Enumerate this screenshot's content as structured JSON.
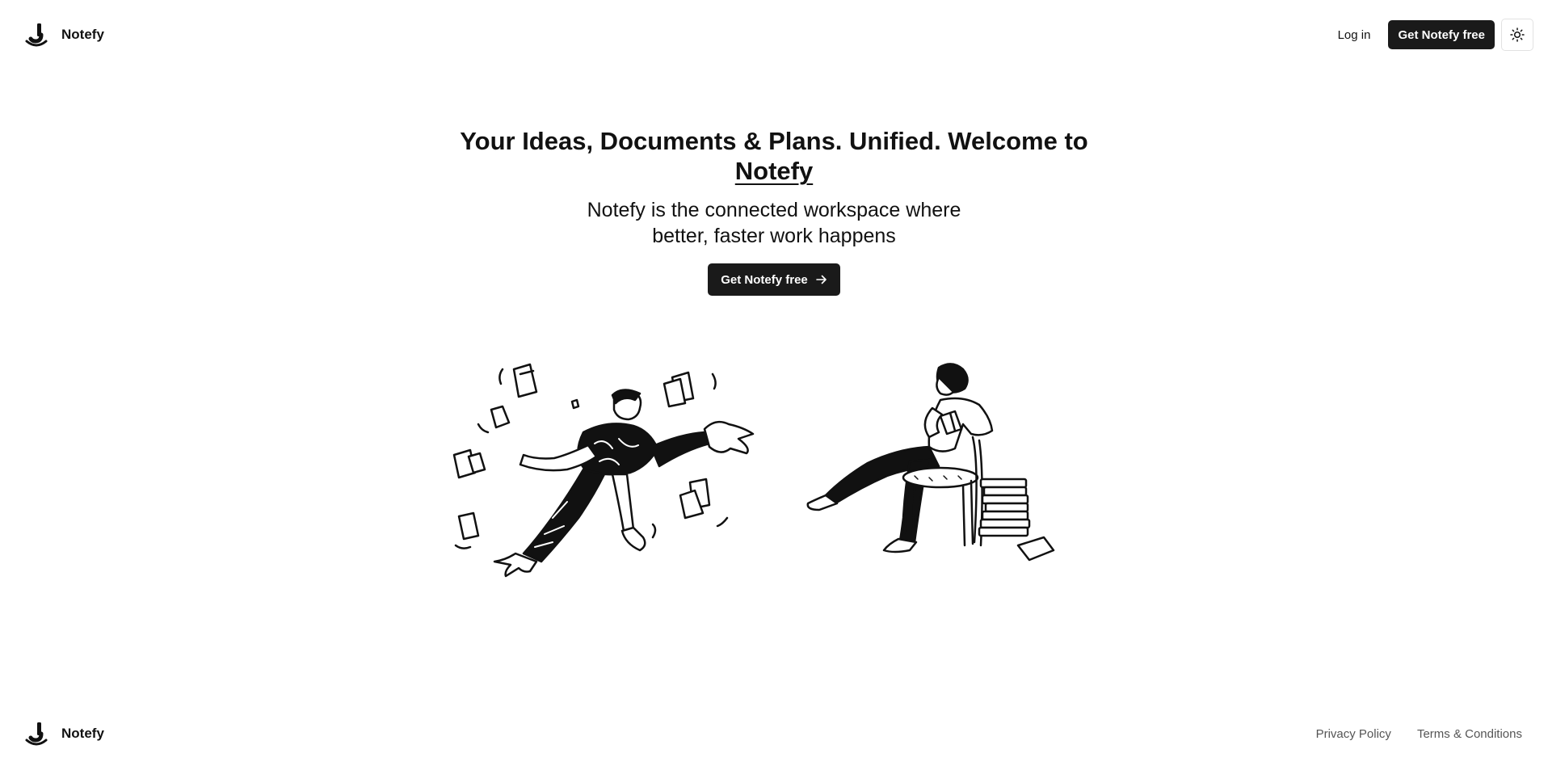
{
  "header": {
    "brand_name": "Notefy",
    "login_label": "Log in",
    "cta_label": "Get Notefy free"
  },
  "hero": {
    "title_prefix": "Your Ideas, Documents & Plans. Unified. Welcome to ",
    "title_brand": "Notefy",
    "subtitle": "Notefy is the connected workspace where better, faster work happens",
    "cta_label": "Get Notefy free"
  },
  "footer": {
    "brand_name": "Notefy",
    "privacy_label": "Privacy Policy",
    "terms_label": "Terms & Conditions"
  },
  "icons": {
    "logo": "notefy-logo-icon",
    "theme": "sun-icon",
    "arrow": "arrow-right-icon"
  },
  "colors": {
    "primary_dark": "#1a1a1a",
    "background": "#ffffff",
    "muted_text": "#555555"
  }
}
